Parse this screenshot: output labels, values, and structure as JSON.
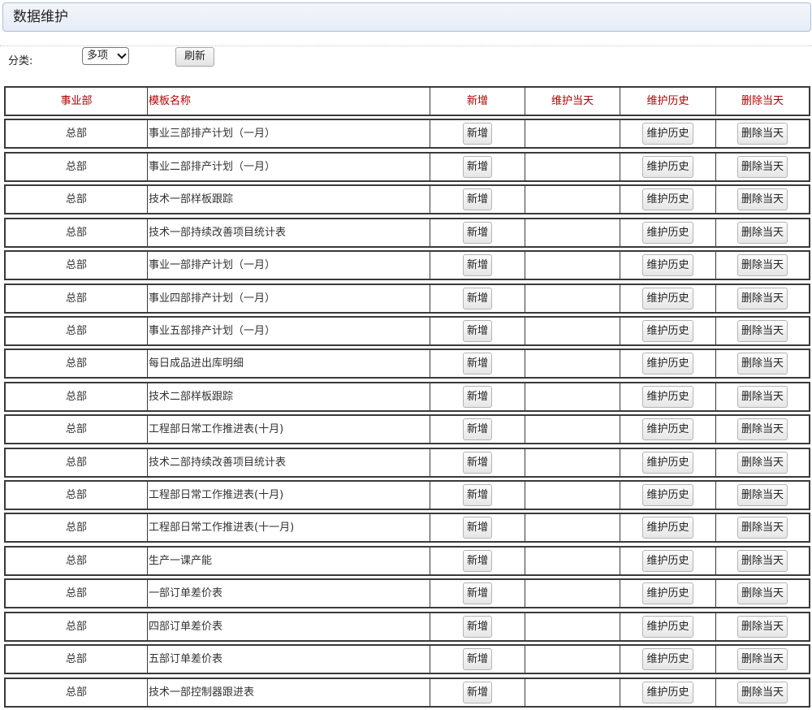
{
  "page": {
    "title": "数据维护"
  },
  "toolbar": {
    "category_label": "分类:",
    "category_value": "多项",
    "refresh_label": "刷新"
  },
  "table": {
    "headers": [
      "事业部",
      "模板名称",
      "新增",
      "维护当天",
      "维护历史",
      "删除当天"
    ],
    "button_labels": {
      "add": "新增",
      "history": "维护历史",
      "delete_today": "删除当天"
    },
    "rows": [
      {
        "dept": "总部",
        "template": "事业三部排产计划（一月）"
      },
      {
        "dept": "总部",
        "template": "事业二部排产计划（一月）"
      },
      {
        "dept": "总部",
        "template": "技术一部样板跟踪"
      },
      {
        "dept": "总部",
        "template": "技术一部持续改善项目统计表"
      },
      {
        "dept": "总部",
        "template": "事业一部排产计划（一月）"
      },
      {
        "dept": "总部",
        "template": "事业四部排产计划（一月）"
      },
      {
        "dept": "总部",
        "template": "事业五部排产计划（一月）"
      },
      {
        "dept": "总部",
        "template": "每日成品进出库明细"
      },
      {
        "dept": "总部",
        "template": "技术二部样板跟踪"
      },
      {
        "dept": "总部",
        "template": "工程部日常工作推进表(十月)"
      },
      {
        "dept": "总部",
        "template": "技术二部持续改善项目统计表"
      },
      {
        "dept": "总部",
        "template": "工程部日常工作推进表(十月)"
      },
      {
        "dept": "总部",
        "template": "工程部日常工作推进表(十一月)"
      },
      {
        "dept": "总部",
        "template": "生产一课产能"
      },
      {
        "dept": "总部",
        "template": "一部订单差价表"
      },
      {
        "dept": "总部",
        "template": "四部订单差价表"
      },
      {
        "dept": "总部",
        "template": "五部订单差价表"
      },
      {
        "dept": "总部",
        "template": "技术一部控制器跟进表"
      }
    ]
  }
}
